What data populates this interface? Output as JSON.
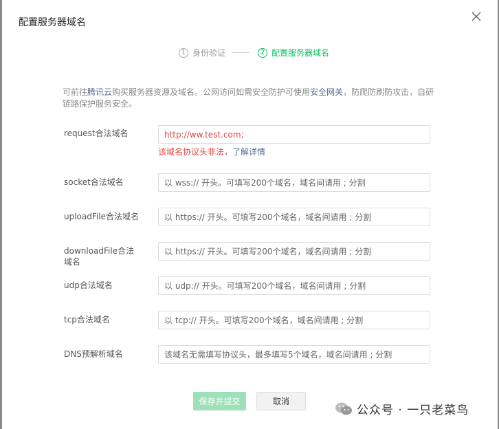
{
  "dialog": {
    "title": "配置服务器域名",
    "close_icon": "close-icon"
  },
  "steps": [
    {
      "num": "1",
      "label": "身份验证",
      "state": "done"
    },
    {
      "num": "2",
      "label": "配置服务器域名",
      "state": "active"
    }
  ],
  "intro": {
    "part1": "可前往",
    "link1": "腾讯云",
    "part2": "购买服务器资源及域名。公网访问如需安全防护可使用",
    "link2": "安全网关",
    "part3": "，防爬防刷防攻击，自研链路保护服务安全。"
  },
  "fields": {
    "request": {
      "label": "request合法域名",
      "value": "http://ww.test.com;"
    },
    "request_error": {
      "text": "该域名协议头非法，",
      "link": "了解详情"
    },
    "socket": {
      "label": "socket合法域名",
      "placeholder": "以 wss:// 开头。可填写200个域名，域名间请用 ; 分割"
    },
    "uploadFile": {
      "label": "uploadFile合法域名",
      "placeholder": "以 https:// 开头。可填写200个域名，域名间请用 ; 分割"
    },
    "downloadFile": {
      "label": "downloadFile合法域名",
      "placeholder": "以 https:// 开头。可填写200个域名，域名间请用 ; 分割"
    },
    "udp": {
      "label": "udp合法域名",
      "placeholder": "以 udp:// 开头。可填写200个域名，域名间请用 ; 分割"
    },
    "tcp": {
      "label": "tcp合法域名",
      "placeholder": "以 tcp:// 开头。可填写200个域名，域名间请用 ; 分割"
    },
    "dns": {
      "label": "DNS预解析域名",
      "placeholder": "该域名无需填写协议头，最多填写5个域名，域名间请用 ; 分割"
    }
  },
  "buttons": {
    "submit": "保存并提交",
    "cancel": "取消"
  },
  "watermark": {
    "text": "公众号 · 一只老菜鸟",
    "icon": "wechat-icon"
  },
  "colors": {
    "accent": "#07c160",
    "link": "#576b95",
    "error": "#e64340",
    "primary_disabled": "#9ee0b9"
  }
}
